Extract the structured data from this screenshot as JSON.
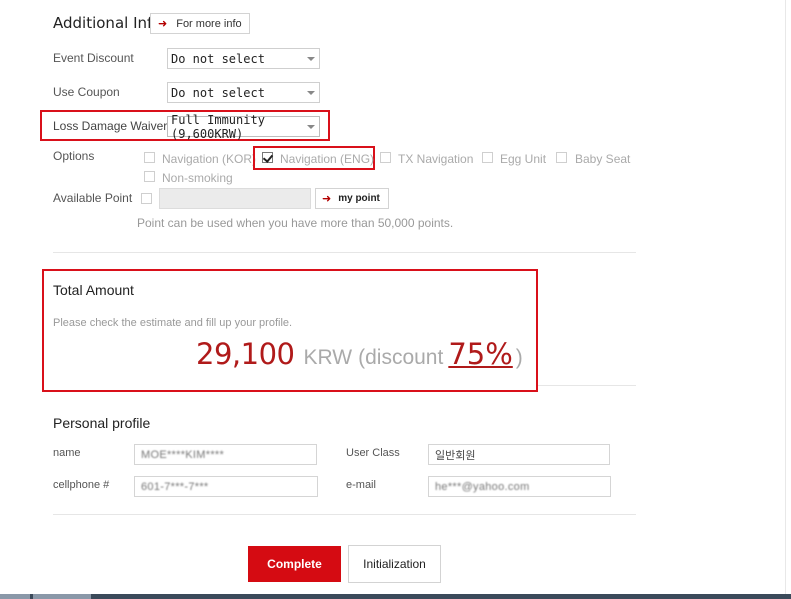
{
  "additional_info": {
    "title": "Additional Info",
    "more_button": "For more info",
    "event_discount": {
      "label": "Event Discount",
      "value": "Do not select"
    },
    "use_coupon": {
      "label": "Use Coupon",
      "value": "Do not select"
    },
    "ldw": {
      "label": "Loss Damage Waiver",
      "value": "Full Immunity (9,600KRW)"
    },
    "options": {
      "label": "Options",
      "items": [
        {
          "label": "Navigation (KOR)",
          "checked": false
        },
        {
          "label": "Navigation (ENG)",
          "checked": true
        },
        {
          "label": "TX Navigation",
          "checked": false
        },
        {
          "label": "Egg Unit",
          "checked": false
        },
        {
          "label": "Baby Seat",
          "checked": false
        },
        {
          "label": "Non-smoking",
          "checked": false
        }
      ]
    },
    "available_point": {
      "label": "Available Point",
      "button": "my point",
      "value": "",
      "note": "Point can be used when you have more than 50,000 points."
    }
  },
  "total": {
    "title": "Total Amount",
    "note": "Please check the estimate and fill up your profile.",
    "amount": "29,100",
    "currency": "KRW",
    "open": "(discount",
    "discount": "75%",
    "close": ")"
  },
  "profile": {
    "title": "Personal profile",
    "name": {
      "label": "name",
      "value": "MOE****KIM****"
    },
    "user_class": {
      "label": "User Class",
      "value": "일반회원"
    },
    "cellphone": {
      "label": "cellphone #",
      "value": "601-7***-7***"
    },
    "email": {
      "label": "e-mail",
      "value": "he***@yahoo.com"
    }
  },
  "actions": {
    "complete": "Complete",
    "initialization": "Initialization"
  },
  "colors": {
    "accent": "#d50b12",
    "highlight_box": "#d9101a",
    "amount": "#b01a1a"
  }
}
